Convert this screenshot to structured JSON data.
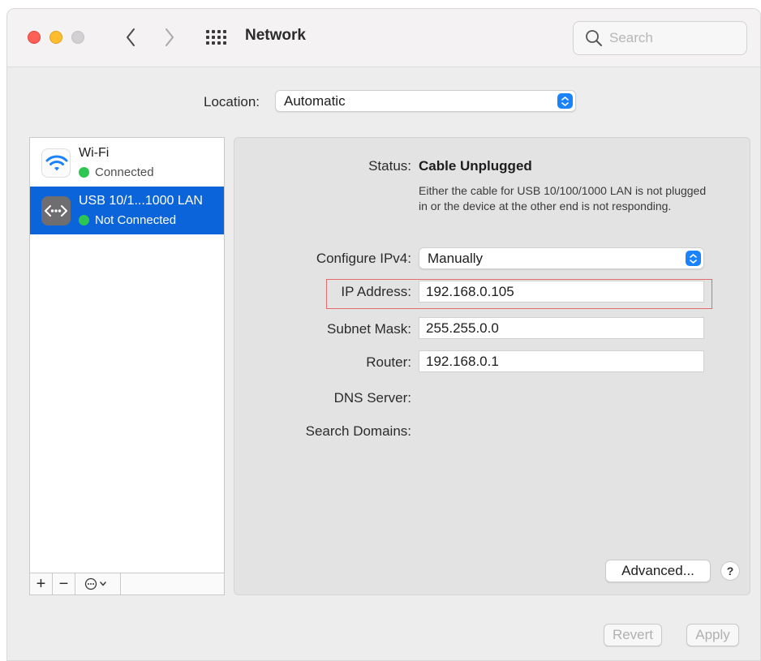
{
  "window": {
    "title": "Network",
    "search_placeholder": "Search"
  },
  "location": {
    "label": "Location:",
    "value": "Automatic"
  },
  "sidebar": {
    "services": [
      {
        "name": "Wi-Fi",
        "status": "Connected",
        "status_color": "#2dc653",
        "icon": "wifi-icon"
      },
      {
        "name": "USB 10/1...1000 LAN",
        "status": "Not Connected",
        "status_color": "#2dc653",
        "icon": "ethernet-icon"
      }
    ],
    "toolbar": {
      "add": "+",
      "remove": "−"
    }
  },
  "details": {
    "status_label": "Status:",
    "status_value": "Cable Unplugged",
    "status_description": "Either the cable for USB 10/100/1000 LAN is not plugged in or the device at the other end is not responding.",
    "configure_label": "Configure IPv4:",
    "configure_value": "Manually",
    "ip_label": "IP Address:",
    "ip_value": "192.168.0.105",
    "subnet_label": "Subnet Mask:",
    "subnet_value": "255.255.0.0",
    "router_label": "Router:",
    "router_value": "192.168.0.1",
    "dns_label": "DNS Server:",
    "search_domains_label": "Search Domains:",
    "advanced_label": "Advanced...",
    "help_label": "?"
  },
  "footer": {
    "revert_label": "Revert",
    "apply_label": "Apply"
  },
  "colors": {
    "accent": "#0b64d9",
    "highlight_box": "#e26b6b"
  }
}
